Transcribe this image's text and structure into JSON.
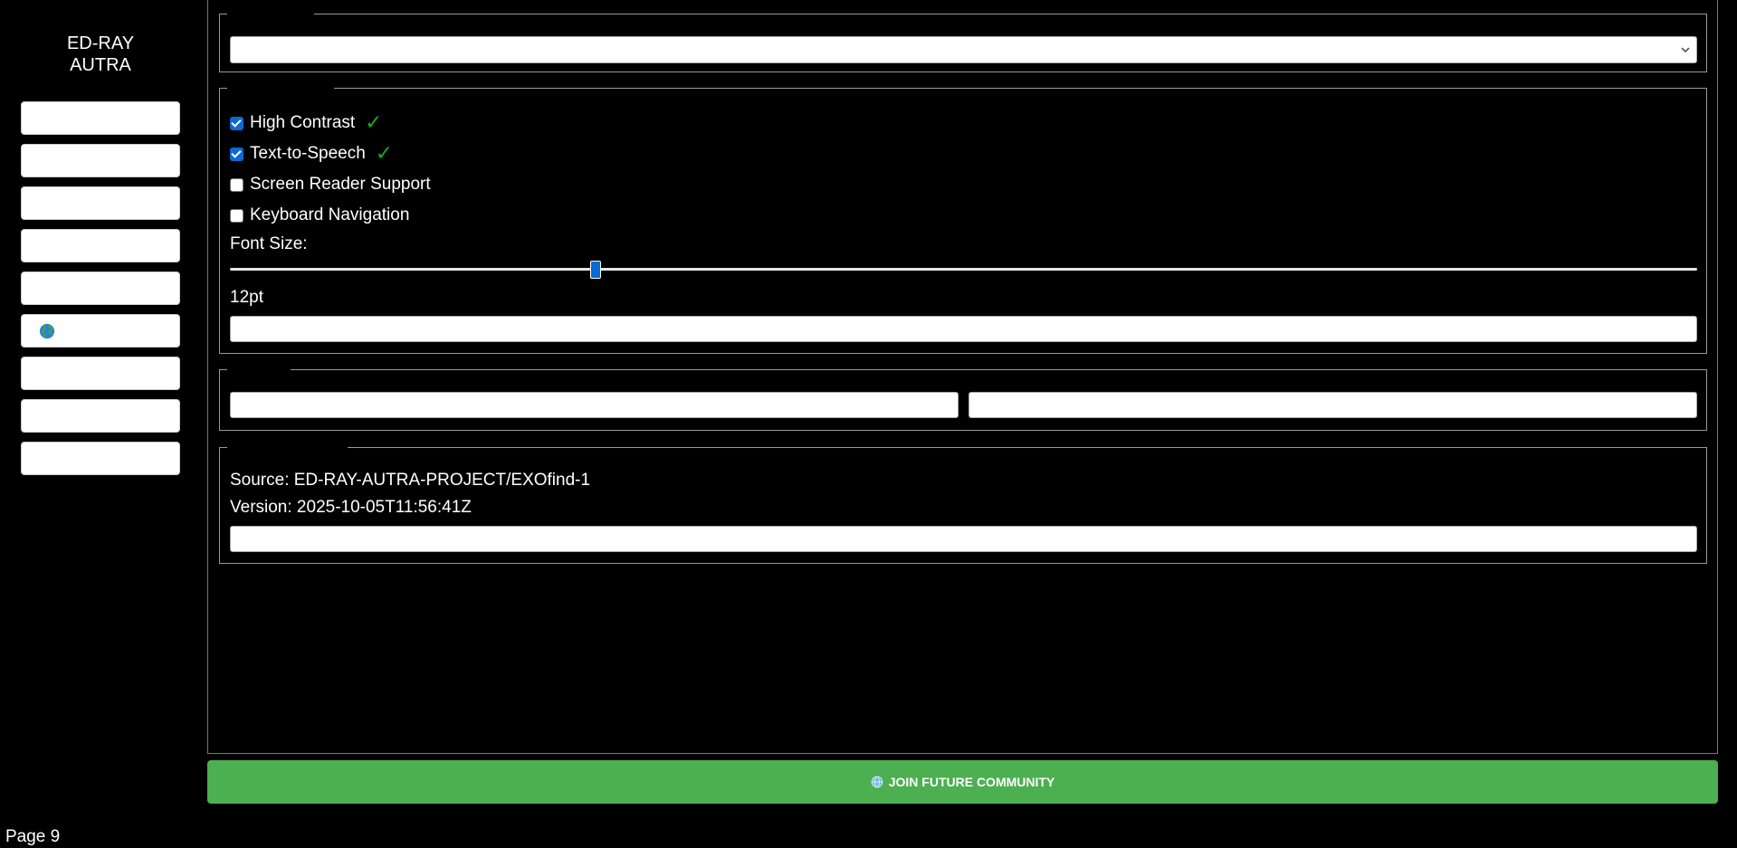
{
  "brand": {
    "line1": "ED-RAY",
    "line2": "AUTRA"
  },
  "sidebar": {
    "items": [
      {
        "label": ""
      },
      {
        "label": ""
      },
      {
        "label": ""
      },
      {
        "label": ""
      },
      {
        "label": ""
      },
      {
        "label": "",
        "icon": "globe-icon"
      },
      {
        "label": ""
      },
      {
        "label": ""
      },
      {
        "label": ""
      }
    ]
  },
  "language": {
    "selected": ""
  },
  "accessibility": {
    "options": [
      {
        "label": "High Contrast",
        "checked": true,
        "status": "✓"
      },
      {
        "label": "Text-to-Speech",
        "checked": true,
        "status": "✓"
      },
      {
        "label": "Screen Reader Support",
        "checked": false
      },
      {
        "label": "Keyboard Navigation",
        "checked": false
      }
    ],
    "font_size_label": "Font Size:",
    "font_size_value": "12pt",
    "font_size_slider_fraction": 0.25,
    "apply_label": ""
  },
  "actions": {
    "left_label": "",
    "right_label": ""
  },
  "about": {
    "source": "Source: ED-RAY-AUTRA-PROJECT/EXOfind-1",
    "version": "Version: 2025-10-05T11:56:41Z",
    "button_label": ""
  },
  "join": {
    "label": "JOIN FUTURE COMMUNITY",
    "icon": "globe-icon",
    "color": "#4caf50"
  },
  "footer": {
    "page_label": "Page 9"
  },
  "colors": {
    "accent": "#0b6ad1",
    "success": "#1aa81a"
  }
}
